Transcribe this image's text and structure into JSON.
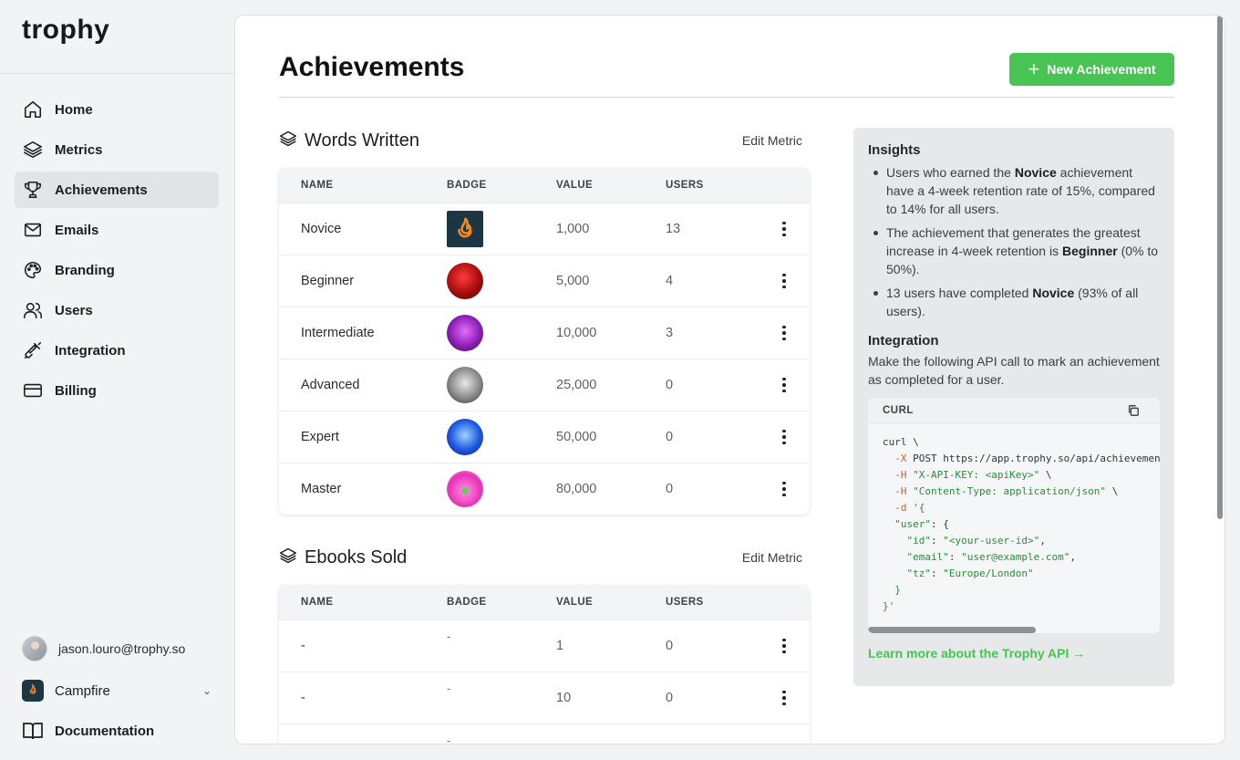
{
  "app": {
    "logo": "trophy"
  },
  "sidebar": {
    "items": [
      {
        "label": "Home",
        "icon": "home-icon"
      },
      {
        "label": "Metrics",
        "icon": "layers-icon"
      },
      {
        "label": "Achievements",
        "icon": "trophy-icon",
        "active": true
      },
      {
        "label": "Emails",
        "icon": "mail-icon"
      },
      {
        "label": "Branding",
        "icon": "palette-icon"
      },
      {
        "label": "Users",
        "icon": "users-icon"
      },
      {
        "label": "Integration",
        "icon": "plug-icon"
      },
      {
        "label": "Billing",
        "icon": "credit-card-icon"
      }
    ],
    "user_email": "jason.louro@trophy.so",
    "org_name": "Campfire",
    "documentation": "Documentation"
  },
  "page": {
    "title": "Achievements",
    "new_button": "New Achievement",
    "accent": "#47c453"
  },
  "table_headers": {
    "name": "NAME",
    "badge": "BADGE",
    "value": "VALUE",
    "users": "USERS"
  },
  "metrics": [
    {
      "title": "Words Written",
      "edit_label": "Edit Metric",
      "rows": [
        {
          "name": "Novice",
          "value": "1,000",
          "users": "13",
          "badge": "flame-badge"
        },
        {
          "name": "Beginner",
          "value": "5,000",
          "users": "4",
          "badge": "red-badge"
        },
        {
          "name": "Intermediate",
          "value": "10,000",
          "users": "3",
          "badge": "purple-badge"
        },
        {
          "name": "Advanced",
          "value": "25,000",
          "users": "0",
          "badge": "grey-badge"
        },
        {
          "name": "Expert",
          "value": "50,000",
          "users": "0",
          "badge": "blue-badge"
        },
        {
          "name": "Master",
          "value": "80,000",
          "users": "0",
          "badge": "pink-badge"
        }
      ]
    },
    {
      "title": "Ebooks Sold",
      "edit_label": "Edit Metric",
      "rows": [
        {
          "name": "-",
          "badge_text": "-",
          "value": "1",
          "users": "0"
        },
        {
          "name": "-",
          "badge_text": "-",
          "value": "10",
          "users": "0"
        },
        {
          "name": "",
          "badge_text": "-",
          "value": "",
          "users": ""
        }
      ]
    }
  ],
  "insights": {
    "heading": "Insights",
    "bullet1": {
      "pre": "Users who earned the ",
      "bold": "Novice",
      "post": " achievement have a 4-week retention rate of 15%, compared to 14% for all users."
    },
    "bullet2": {
      "pre": "The achievement that generates the greatest increase in 4-week retention is ",
      "bold": "Beginner",
      "post": " (0% to 50%)."
    },
    "bullet3": {
      "pre": "13 users have completed ",
      "bold": "Novice",
      "post": " (93% of all users)."
    },
    "integration_heading": "Integration",
    "integration_text": "Make the following API call to mark an achievement as completed for a user.",
    "code_label": "CURL",
    "code": {
      "l1": "curl \\",
      "l2_flag": "-X",
      "l2_rest": " POST https://app.trophy.so/api/achievements",
      "l3_flag": "-H",
      "l3_str": "\"X-API-KEY: <apiKey>\"",
      "l3_rest": " \\",
      "l4_flag": "-H",
      "l4_str": "\"Content-Type: application/json\"",
      "l4_rest": " \\",
      "l5_flag": "-d",
      "l5_str": "'{",
      "l6_str": "\"user\"",
      "l6_rest": ": {",
      "l7_key": "\"id\"",
      "l7_val": "\"<your-user-id>\"",
      "l8_key": "\"email\"",
      "l8_val": "\"user@example.com\"",
      "l9_key": "\"tz\"",
      "l9_val": "\"Europe/London\"",
      "l10": "}",
      "l11": "}'"
    },
    "learn_more": "Learn more about the Trophy API →"
  }
}
